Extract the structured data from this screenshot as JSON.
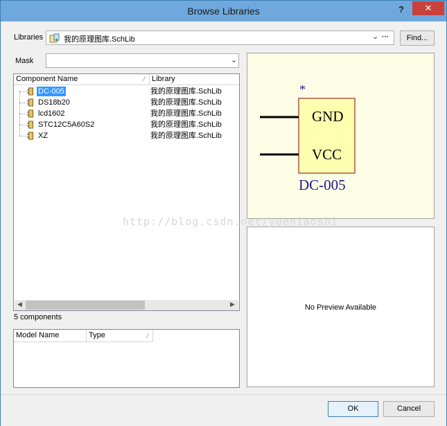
{
  "window": {
    "title": "Browse Libraries",
    "help_glyph": "?",
    "close_glyph": "✕"
  },
  "libraries": {
    "label": "Libraries",
    "value": "我的原理图库.SchLib",
    "more": "···",
    "find_label": "Find..."
  },
  "mask": {
    "label": "Mask",
    "value": ""
  },
  "component_table": {
    "headers": [
      "Component Name",
      "Library"
    ],
    "rows": [
      {
        "name": "DC-005",
        "library": "我的原理图库.SchLib",
        "selected": true
      },
      {
        "name": "DS18b20",
        "library": "我的原理图库.SchLib",
        "selected": false
      },
      {
        "name": "lcd1602",
        "library": "我的原理图库.SchLib",
        "selected": false
      },
      {
        "name": "STC12C5A60S2",
        "library": "我的原理图库.SchLib",
        "selected": false
      },
      {
        "name": "XZ",
        "library": "我的原理图库.SchLib",
        "selected": false
      }
    ],
    "count_text": "5 components"
  },
  "model_table": {
    "headers": [
      "Model Name",
      "Type"
    ]
  },
  "symbol_preview": {
    "designator_mark": "*",
    "pins": [
      "GND",
      "VCC"
    ],
    "part_name": "DC-005",
    "body_color": "#ffffb0",
    "body_border": "#8b0000",
    "text_color": "#1a1a8c"
  },
  "model_preview": {
    "text": "No Preview Available"
  },
  "watermark": "http://blog.csdn.net/yueniaoshi",
  "buttons": {
    "ok": "OK",
    "cancel": "Cancel"
  }
}
